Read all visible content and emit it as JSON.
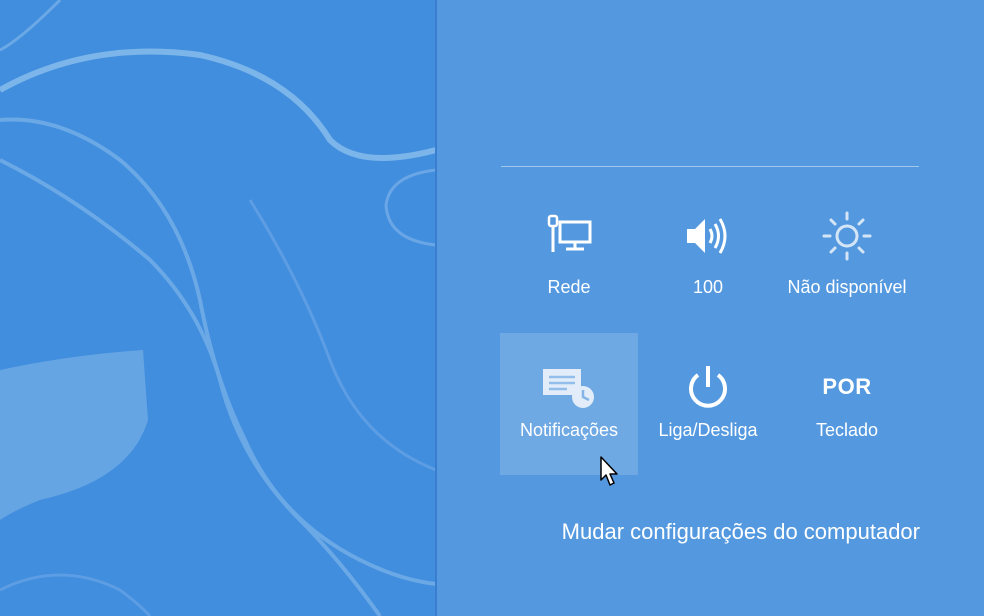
{
  "settings_charm": {
    "tiles": [
      {
        "label": "Rede",
        "icon": "network-icon"
      },
      {
        "label": "100",
        "icon": "volume-icon"
      },
      {
        "label": "Não disponível",
        "icon": "brightness-icon"
      },
      {
        "label": "Notificações",
        "icon": "notifications-icon"
      },
      {
        "label": "Liga/Desliga",
        "icon": "power-icon"
      },
      {
        "label": "Teclado",
        "icon": "keyboard-language",
        "icon_text": "POR"
      }
    ],
    "change_pc_settings": "Mudar configurações do computador"
  },
  "colors": {
    "desktop_background": "#418ede",
    "charm_background": "#5499df",
    "text": "#ffffff"
  }
}
